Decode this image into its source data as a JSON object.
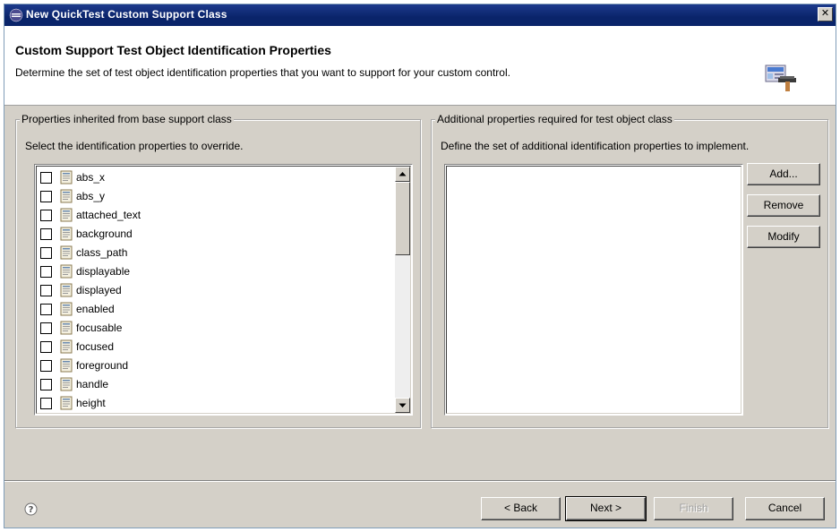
{
  "window": {
    "title": "New QuickTest Custom Support Class",
    "close_label": "✕"
  },
  "header": {
    "title": "Custom Support Test Object Identification Properties",
    "description": "Determine the set of test object identification properties that you want to support for your custom control."
  },
  "left_group": {
    "legend": "Properties inherited from base support class",
    "instruction": "Select the identification properties to override.",
    "properties": [
      {
        "label": "abs_x",
        "checked": false
      },
      {
        "label": "abs_y",
        "checked": false
      },
      {
        "label": "attached_text",
        "checked": false
      },
      {
        "label": "background",
        "checked": false
      },
      {
        "label": "class_path",
        "checked": false
      },
      {
        "label": "displayable",
        "checked": false
      },
      {
        "label": "displayed",
        "checked": false
      },
      {
        "label": "enabled",
        "checked": false
      },
      {
        "label": "focusable",
        "checked": false
      },
      {
        "label": "focused",
        "checked": false
      },
      {
        "label": "foreground",
        "checked": false
      },
      {
        "label": "handle",
        "checked": false
      },
      {
        "label": "height",
        "checked": false
      }
    ]
  },
  "right_group": {
    "legend": "Additional properties required for test object class",
    "instruction": "Define the set of additional identification properties to implement.",
    "buttons": {
      "add": "Add...",
      "remove": "Remove",
      "modify": "Modify"
    }
  },
  "footer": {
    "back": "< Back",
    "next": "Next >",
    "finish": "Finish",
    "cancel": "Cancel"
  },
  "icons": {
    "title": "eclipse-icon",
    "header": "wizard-toolbox-icon",
    "property": "property-icon",
    "help": "help-icon"
  }
}
